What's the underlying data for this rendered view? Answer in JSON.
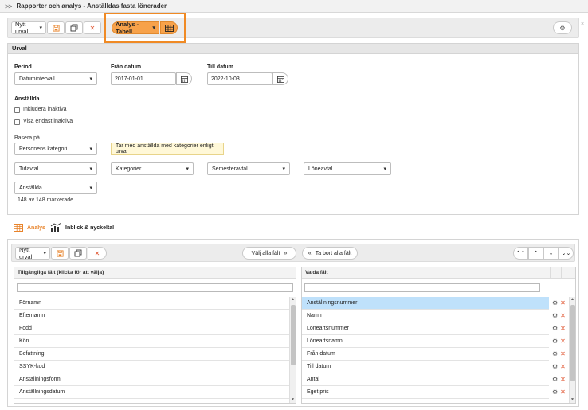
{
  "window": {
    "title": "Rapporter och analys - Anställdas fasta lönerader"
  },
  "toolbar": {
    "selection_value": "Nytt urval",
    "analysis_value": "Analys - Tabell"
  },
  "urval": {
    "section_title": "Urval",
    "period_label": "Period",
    "period_value": "Datumintervall",
    "from_label": "Från datum",
    "from_value": "2017-01-01",
    "to_label": "Till datum",
    "to_value": "2022-10-03",
    "employees_label": "Anställda",
    "include_inactive": "Inkludera inaktiva",
    "only_inactive": "Visa endast inaktiva",
    "base_label": "Basera på",
    "base_value": "Personens kategori",
    "base_tip": "Tar med anställda med kategorier enligt urval",
    "filters": [
      "Tidavtal",
      "Kategorier",
      "Semesteravtal",
      "Löneavtal"
    ],
    "employees_select": "Anställda",
    "marked_count": "148 av 148 markerade"
  },
  "analysis_tabs": {
    "analys": "Analys",
    "inblick": "Inblick & nyckeltal"
  },
  "fields_toolbar": {
    "selection_value": "Nytt urval",
    "choose_all": "Välj alla fält",
    "remove_all": "Ta bort alla fält"
  },
  "available_fields": {
    "header": "Tillgängliga fält (klicka för att välja)",
    "items": [
      "Förnamn",
      "Efternamn",
      "Född",
      "Kön",
      "Befattning",
      "SSYK-kod",
      "Anställningsform",
      "Anställningsdatum"
    ]
  },
  "selected_fields": {
    "header": "Valda fält",
    "items": [
      "Anställningsnummer",
      "Namn",
      "Löneartsnummer",
      "Löneartsnamn",
      "Från datum",
      "Till datum",
      "Antal",
      "Eget pris"
    ]
  },
  "colors": {
    "accent": "#f7a24a",
    "highlight_border": "#f08a24",
    "selected_row": "#bfe1fb",
    "delete": "#e0532e"
  }
}
